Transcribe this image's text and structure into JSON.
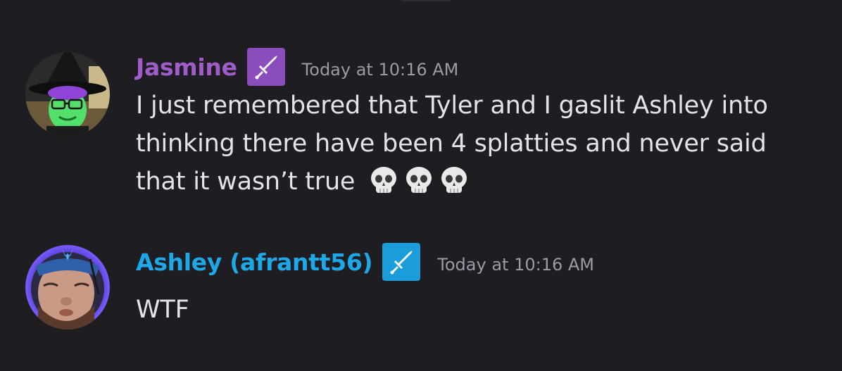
{
  "messages": [
    {
      "username": "Jasmine",
      "username_color": "#a05cc8",
      "badge_color": "#8b4dbd",
      "badge_icon": "sword-icon",
      "timestamp": "Today at 10:16 AM",
      "text": "I just remembered that Tyler and I gaslit Ashley into thinking there have been 4 splatties and never said that it wasn’t true",
      "emojis": [
        "skull-emoji",
        "skull-emoji",
        "skull-emoji"
      ]
    },
    {
      "username": "Ashley (afrantt56)",
      "username_color": "#1fa8e8",
      "badge_color": "#1b9ddc",
      "badge_icon": "sword-icon",
      "timestamp": "Today at 10:16 AM",
      "text": "WTF"
    }
  ]
}
